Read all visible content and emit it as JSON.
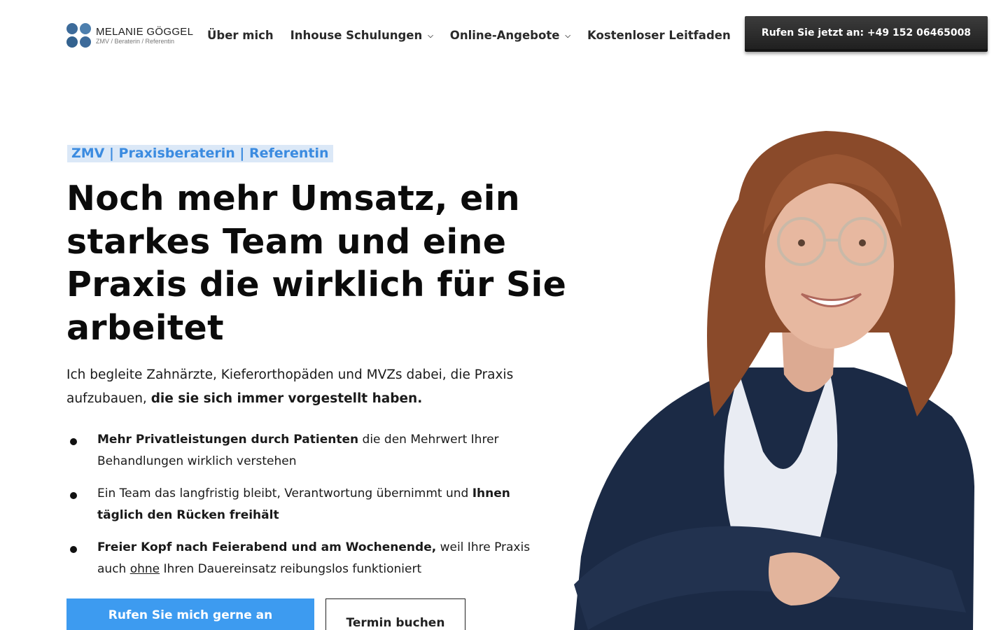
{
  "header": {
    "logo": {
      "name": "MELANIE GÖGGEL",
      "subtitle": "ZMV / Beraterin / Referentin"
    },
    "nav": [
      {
        "label": "Über mich",
        "has_dropdown": false
      },
      {
        "label": "Inhouse Schulungen",
        "has_dropdown": true
      },
      {
        "label": "Online-Angebote",
        "has_dropdown": true
      },
      {
        "label": "Kostenloser Leitfaden",
        "has_dropdown": false
      }
    ],
    "cta_label": "Rufen Sie jetzt an: +49 152 06465008"
  },
  "hero": {
    "tagline": "ZMV | Praxisberaterin | Referentin",
    "headline": "Noch mehr Umsatz, ein starkes Team und eine Praxis die wirklich für Sie arbeitet",
    "intro_regular": "Ich begleite Zahnärzte, Kieferorthopäden und MVZs dabei, die Praxis aufzubauen, ",
    "intro_bold": "die sie sich immer vorgestellt haben.",
    "bullets": [
      {
        "bold": "Mehr Privatleistungen durch Patienten",
        "text": " die den Mehrwert Ihrer Behandlungen wirklich verstehen"
      },
      {
        "text": "Ein Team das langfristig bleibt, Verantwortung übernimmt und ",
        "bold": "Ihnen täglich den Rücken freihält"
      },
      {
        "bold": "Freier Kopf nach Feierabend und am Wochenende,",
        "text": " weil Ihre Praxis auch ",
        "underlined": "ohne",
        "text_end": " Ihren Dauereinsatz reibungslos funktioniert"
      }
    ],
    "primary_button": "Rufen Sie mich gerne an",
    "secondary_button": "Termin buchen"
  },
  "colors": {
    "accent_blue": "#3d9bf0",
    "tagline_bg": "#dbe8f7",
    "tagline_text": "#3b8be0",
    "dark_button": "#2b2b2b",
    "logo_blue": "#3d6b9a"
  },
  "icons": {
    "logo_mark": "four-dots-logo-icon",
    "dropdown": "chevron-down-icon",
    "bullet": "bullet-dot-icon"
  }
}
